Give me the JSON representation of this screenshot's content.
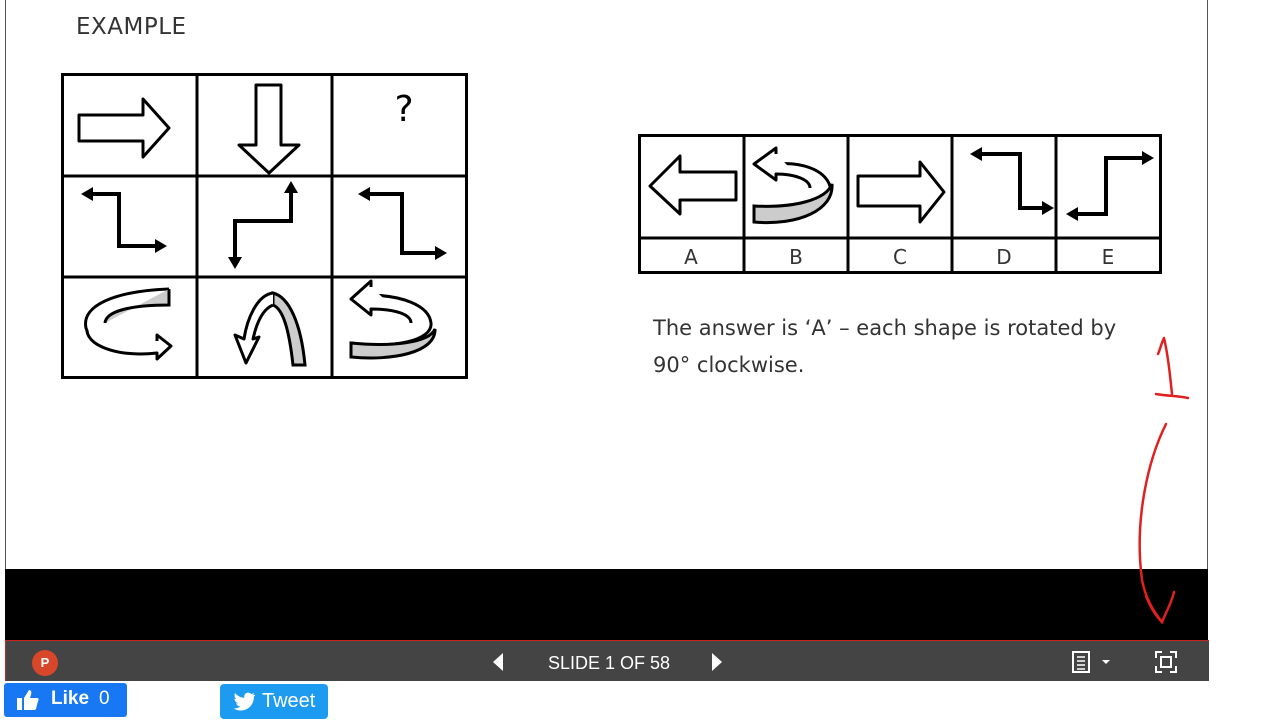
{
  "slide": {
    "heading": "EXAMPLE",
    "grid_question_mark": "?",
    "answer_options": [
      "A",
      "B",
      "C",
      "D",
      "E"
    ],
    "answer_text": "The answer is ‘A’ – each shape is rotated by 90° clockwise."
  },
  "toolbar": {
    "app_icon": "powerpoint-icon",
    "app_icon_letter": "P",
    "slide_counter": "SLIDE 1 OF 58",
    "prev_icon": "triangle-left-icon",
    "next_icon": "triangle-right-icon",
    "notes_icon": "notes-menu-icon",
    "fullscreen_icon": "fullscreen-icon"
  },
  "social": {
    "like_label": "Like",
    "like_count": "0",
    "tweet_label": "Tweet"
  },
  "colors": {
    "toolbar_bg": "#444444",
    "annotation_red": "#e02020",
    "facebook_blue": "#1877f2",
    "twitter_blue": "#1d9bf0"
  }
}
